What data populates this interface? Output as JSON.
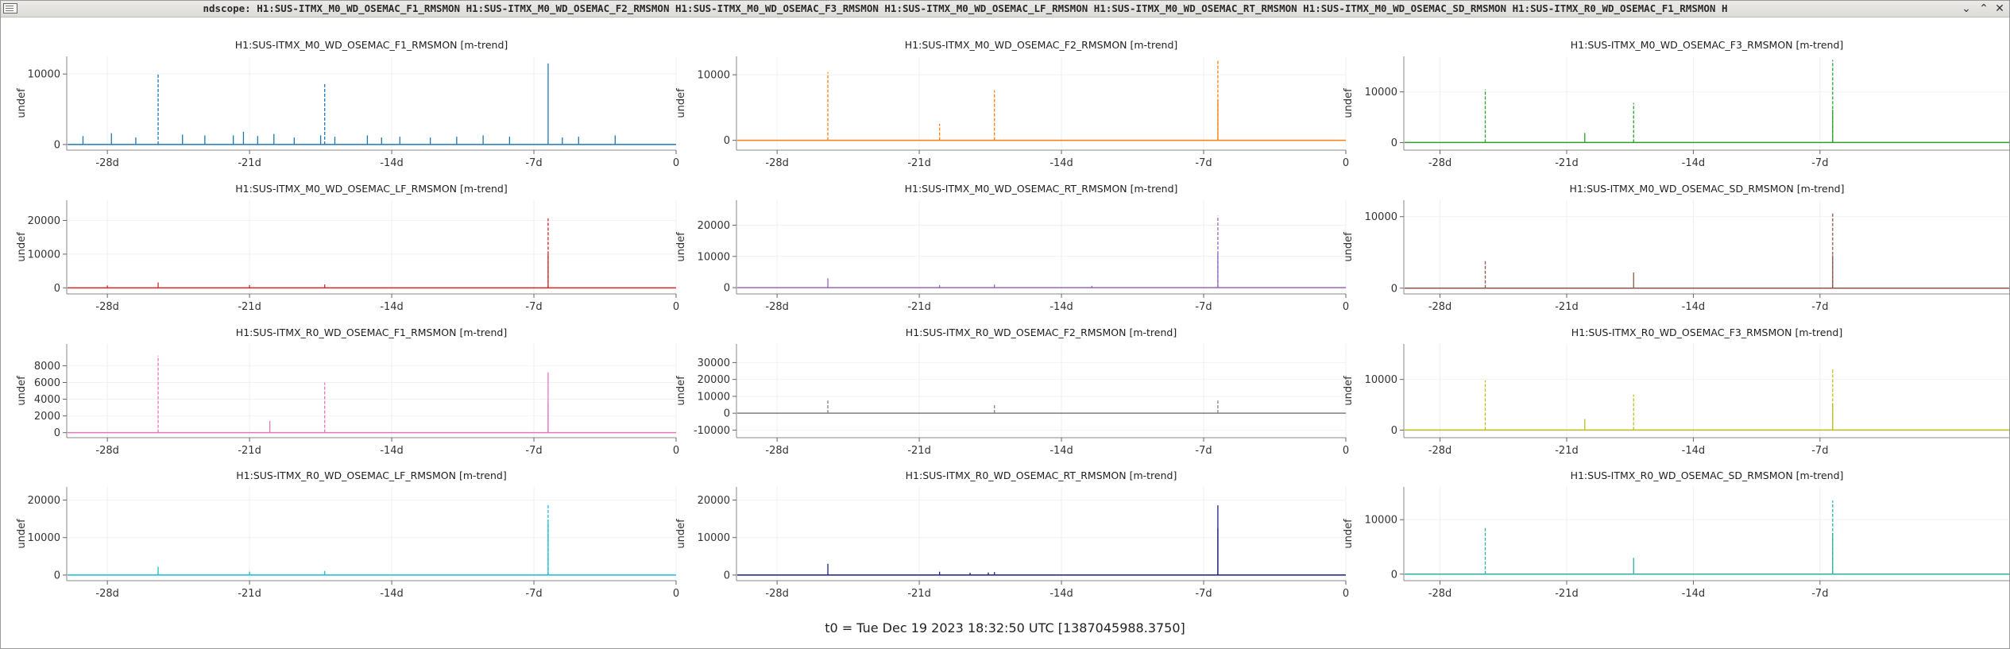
{
  "window": {
    "title": "ndscope: H1:SUS-ITMX_M0_WD_OSEMAC_F1_RMSMON H1:SUS-ITMX_M0_WD_OSEMAC_F2_RMSMON H1:SUS-ITMX_M0_WD_OSEMAC_F3_RMSMON H1:SUS-ITMX_M0_WD_OSEMAC_LF_RMSMON H1:SUS-ITMX_M0_WD_OSEMAC_RT_RMSMON H1:SUS-ITMX_M0_WD_OSEMAC_SD_RMSMON H1:SUS-ITMX_R0_WD_OSEMAC_F1_RMSMON H",
    "minimize_icon": "chevron-down-icon",
    "maximize_icon": "chevron-up-icon",
    "close_icon": "close-icon",
    "min_glyph": "⌄",
    "max_glyph": "⌃",
    "close_glyph": "✕"
  },
  "t0_label": "t0 = Tue Dec 19 2023 18:32:50 UTC [1387045988.3750]",
  "chart_data": [
    {
      "type": "line",
      "title": "H1:SUS-ITMX_M0_WD_OSEMAC_F1_RMSMON [m-trend]",
      "ylabel": "undef",
      "color": "#1f77b4",
      "xlim": [
        -30,
        0
      ],
      "ylim": [
        -800,
        12500
      ],
      "xticks": [
        {
          "v": -28,
          "label": "-28d"
        },
        {
          "v": -21,
          "label": "-21d"
        },
        {
          "v": -14,
          "label": "-14d"
        },
        {
          "v": -7,
          "label": "-7d"
        },
        {
          "v": 0,
          "label": "0"
        }
      ],
      "yticks": [
        {
          "v": 0,
          "label": "0"
        },
        {
          "v": 10000,
          "label": "10000"
        }
      ],
      "spikes": [
        {
          "x": -29.2,
          "y": 1200
        },
        {
          "x": -27.8,
          "y": 1600
        },
        {
          "x": -26.6,
          "y": 1000
        },
        {
          "x": -25.5,
          "y": 10000,
          "dashed": true
        },
        {
          "x": -24.3,
          "y": 1400
        },
        {
          "x": -23.2,
          "y": 1300
        },
        {
          "x": -21.8,
          "y": 1300
        },
        {
          "x": -21.3,
          "y": 1800
        },
        {
          "x": -20.6,
          "y": 1200
        },
        {
          "x": -19.8,
          "y": 1500
        },
        {
          "x": -18.8,
          "y": 1000
        },
        {
          "x": -17.5,
          "y": 1300
        },
        {
          "x": -17.3,
          "y": 8800,
          "dashed": true
        },
        {
          "x": -16.8,
          "y": 1100
        },
        {
          "x": -15.2,
          "y": 1300
        },
        {
          "x": -14.5,
          "y": 1000
        },
        {
          "x": -13.6,
          "y": 1100
        },
        {
          "x": -12.1,
          "y": 1000
        },
        {
          "x": -10.8,
          "y": 1100
        },
        {
          "x": -9.5,
          "y": 1300
        },
        {
          "x": -8.2,
          "y": 1100
        },
        {
          "x": -6.3,
          "y": 11500
        },
        {
          "x": -5.6,
          "y": 1000
        },
        {
          "x": -4.8,
          "y": 1100
        },
        {
          "x": -3.0,
          "y": 1300
        }
      ]
    },
    {
      "type": "line",
      "title": "H1:SUS-ITMX_M0_WD_OSEMAC_F2_RMSMON [m-trend]",
      "ylabel": "undef",
      "color": "#ff7f0e",
      "xlim": [
        -30,
        0
      ],
      "ylim": [
        -1500,
        12800
      ],
      "xticks": [
        {
          "v": -28,
          "label": "-28d"
        },
        {
          "v": -21,
          "label": "-21d"
        },
        {
          "v": -14,
          "label": "-14d"
        },
        {
          "v": -7,
          "label": "-7d"
        },
        {
          "v": 0,
          "label": "0"
        }
      ],
      "yticks": [
        {
          "v": 0,
          "label": "0"
        },
        {
          "v": 10000,
          "label": "10000"
        }
      ],
      "spikes": [
        {
          "x": -25.5,
          "y": 10400,
          "dashed": true
        },
        {
          "x": -20.0,
          "y": 2500,
          "dashed": true
        },
        {
          "x": -17.3,
          "y": 7600,
          "dashed": true
        },
        {
          "x": -6.3,
          "y": 12200,
          "dashed": true
        },
        {
          "x": -6.3,
          "y": 6200
        }
      ]
    },
    {
      "type": "line",
      "title": "H1:SUS-ITMX_M0_WD_OSEMAC_F3_RMSMON [m-trend]",
      "ylabel": "undef",
      "color": "#2ca02c",
      "xlim": [
        -30,
        3.5
      ],
      "ylim": [
        -1500,
        17000
      ],
      "xticks": [
        {
          "v": -28,
          "label": "-28d"
        },
        {
          "v": -21,
          "label": "-21d"
        },
        {
          "v": -14,
          "label": "-14d"
        },
        {
          "v": -7,
          "label": "-7d"
        }
      ],
      "yticks": [
        {
          "v": 0,
          "label": "0"
        },
        {
          "v": 10000,
          "label": "10000"
        }
      ],
      "spikes": [
        {
          "x": -25.5,
          "y": 10500,
          "dashed": true
        },
        {
          "x": -20.0,
          "y": 1900
        },
        {
          "x": -17.3,
          "y": 7800,
          "dashed": true
        },
        {
          "x": -6.3,
          "y": 16300,
          "dashed": true
        },
        {
          "x": -6.3,
          "y": 6500
        }
      ]
    },
    {
      "type": "line",
      "title": "H1:SUS-ITMX_M0_WD_OSEMAC_LF_RMSMON [m-trend]",
      "ylabel": "undef",
      "color": "#d62728",
      "xlim": [
        -30,
        0
      ],
      "ylim": [
        -1800,
        26000
      ],
      "xticks": [
        {
          "v": -28,
          "label": "-28d"
        },
        {
          "v": -21,
          "label": "-21d"
        },
        {
          "v": -14,
          "label": "-14d"
        },
        {
          "v": -7,
          "label": "-7d"
        },
        {
          "v": 0,
          "label": "0"
        }
      ],
      "yticks": [
        {
          "v": 0,
          "label": "0"
        },
        {
          "v": 10000,
          "label": "10000"
        },
        {
          "v": 20000,
          "label": "20000"
        }
      ],
      "spikes": [
        {
          "x": -28.0,
          "y": 700
        },
        {
          "x": -25.5,
          "y": 1600
        },
        {
          "x": -21.0,
          "y": 800
        },
        {
          "x": -17.3,
          "y": 1000
        },
        {
          "x": -6.3,
          "y": 20600,
          "dashed": true
        },
        {
          "x": -6.3,
          "y": 10000
        }
      ]
    },
    {
      "type": "line",
      "title": "H1:SUS-ITMX_M0_WD_OSEMAC_RT_RMSMON [m-trend]",
      "ylabel": "undef",
      "color": "#9467bd",
      "xlim": [
        -30,
        0
      ],
      "ylim": [
        -2000,
        28000
      ],
      "xticks": [
        {
          "v": -28,
          "label": "-28d"
        },
        {
          "v": -21,
          "label": "-21d"
        },
        {
          "v": -14,
          "label": "-14d"
        },
        {
          "v": -7,
          "label": "-7d"
        },
        {
          "v": 0,
          "label": "0"
        }
      ],
      "yticks": [
        {
          "v": 0,
          "label": "0"
        },
        {
          "v": 10000,
          "label": "10000"
        },
        {
          "v": 20000,
          "label": "20000"
        }
      ],
      "spikes": [
        {
          "x": -25.5,
          "y": 3000
        },
        {
          "x": -20.0,
          "y": 800
        },
        {
          "x": -17.3,
          "y": 1000
        },
        {
          "x": -12.5,
          "y": 600
        },
        {
          "x": -6.3,
          "y": 23000,
          "dashed": true
        },
        {
          "x": -6.3,
          "y": 11000
        }
      ]
    },
    {
      "type": "line",
      "title": "H1:SUS-ITMX_M0_WD_OSEMAC_SD_RMSMON [m-trend]",
      "ylabel": "undef",
      "color": "#8c564b",
      "xlim": [
        -30,
        3.5
      ],
      "ylim": [
        -800,
        12300
      ],
      "xticks": [
        {
          "v": -28,
          "label": "-28d"
        },
        {
          "v": -21,
          "label": "-21d"
        },
        {
          "v": -14,
          "label": "-14d"
        },
        {
          "v": -7,
          "label": "-7d"
        }
      ],
      "yticks": [
        {
          "v": 0,
          "label": "0"
        },
        {
          "v": 10000,
          "label": "10000"
        }
      ],
      "spikes": [
        {
          "x": -25.5,
          "y": 3800,
          "dashed": true
        },
        {
          "x": -17.3,
          "y": 2200
        },
        {
          "x": -6.3,
          "y": 10500,
          "dashed": true
        },
        {
          "x": -6.3,
          "y": 4600
        }
      ]
    },
    {
      "type": "line",
      "title": "H1:SUS-ITMX_R0_WD_OSEMAC_F1_RMSMON [m-trend]",
      "ylabel": "undef",
      "color": "#e377c2",
      "xlim": [
        -30,
        0
      ],
      "ylim": [
        -600,
        10600
      ],
      "xticks": [
        {
          "v": -28,
          "label": "-28d"
        },
        {
          "v": -21,
          "label": "-21d"
        },
        {
          "v": -14,
          "label": "-14d"
        },
        {
          "v": -7,
          "label": "-7d"
        },
        {
          "v": 0,
          "label": "0"
        }
      ],
      "yticks": [
        {
          "v": 0,
          "label": "0"
        },
        {
          "v": 2000,
          "label": "2000"
        },
        {
          "v": 4000,
          "label": "4000"
        },
        {
          "v": 6000,
          "label": "6000"
        },
        {
          "v": 8000,
          "label": "8000"
        }
      ],
      "spikes": [
        {
          "x": -25.5,
          "y": 9200,
          "dashed": true
        },
        {
          "x": -20.0,
          "y": 1400
        },
        {
          "x": -17.3,
          "y": 6000,
          "dashed": true
        },
        {
          "x": -6.3,
          "y": 7200
        },
        {
          "x": -6.3,
          "y": 3400
        }
      ]
    },
    {
      "type": "line",
      "title": "H1:SUS-ITMX_R0_WD_OSEMAC_F2_RMSMON [m-trend]",
      "ylabel": "undef",
      "color": "#7f7f7f",
      "xlim": [
        -30,
        0
      ],
      "ylim": [
        -14500,
        41000
      ],
      "xticks": [
        {
          "v": -28,
          "label": "-28d"
        },
        {
          "v": -21,
          "label": "-21d"
        },
        {
          "v": -14,
          "label": "-14d"
        },
        {
          "v": -7,
          "label": "-7d"
        },
        {
          "v": 0,
          "label": "0"
        }
      ],
      "yticks": [
        {
          "v": -10000,
          "label": "-10000"
        },
        {
          "v": 0,
          "label": "0"
        },
        {
          "v": 10000,
          "label": "10000"
        },
        {
          "v": 20000,
          "label": "20000"
        },
        {
          "v": 30000,
          "label": "30000"
        }
      ],
      "spikes": [
        {
          "x": -25.5,
          "y": 7500,
          "dashed": true
        },
        {
          "x": -17.3,
          "y": 5500,
          "dashed": true
        },
        {
          "x": -6.3,
          "y": 7500,
          "dashed": true
        }
      ]
    },
    {
      "type": "line",
      "title": "H1:SUS-ITMX_R0_WD_OSEMAC_F3_RMSMON [m-trend]",
      "ylabel": "undef",
      "color": "#bcbd22",
      "xlim": [
        -30,
        3.5
      ],
      "ylim": [
        -1500,
        17000
      ],
      "xticks": [
        {
          "v": -28,
          "label": "-28d"
        },
        {
          "v": -21,
          "label": "-21d"
        },
        {
          "v": -14,
          "label": "-14d"
        },
        {
          "v": -7,
          "label": "-7d"
        }
      ],
      "yticks": [
        {
          "v": 0,
          "label": "0"
        },
        {
          "v": 10000,
          "label": "10000"
        }
      ],
      "spikes": [
        {
          "x": -25.5,
          "y": 9800,
          "dashed": true
        },
        {
          "x": -20.0,
          "y": 2200
        },
        {
          "x": -17.3,
          "y": 7000,
          "dashed": true
        },
        {
          "x": -6.3,
          "y": 12000,
          "dashed": true
        },
        {
          "x": -6.3,
          "y": 5200
        }
      ]
    },
    {
      "type": "line",
      "title": "H1:SUS-ITMX_R0_WD_OSEMAC_LF_RMSMON [m-trend]",
      "ylabel": "undef",
      "color": "#17becf",
      "xlim": [
        -30,
        0
      ],
      "ylim": [
        -1500,
        23500
      ],
      "xticks": [
        {
          "v": -28,
          "label": "-28d"
        },
        {
          "v": -21,
          "label": "-21d"
        },
        {
          "v": -14,
          "label": "-14d"
        },
        {
          "v": -7,
          "label": "-7d"
        },
        {
          "v": 0,
          "label": "0"
        }
      ],
      "yticks": [
        {
          "v": 0,
          "label": "0"
        },
        {
          "v": 10000,
          "label": "10000"
        },
        {
          "v": 20000,
          "label": "20000"
        }
      ],
      "spikes": [
        {
          "x": -25.5,
          "y": 2200
        },
        {
          "x": -21.0,
          "y": 900
        },
        {
          "x": -17.3,
          "y": 1100
        },
        {
          "x": -6.3,
          "y": 19000,
          "dashed": true
        },
        {
          "x": -6.3,
          "y": 14000
        }
      ]
    },
    {
      "type": "line",
      "title": "H1:SUS-ITMX_R0_WD_OSEMAC_RT_RMSMON [m-trend]",
      "ylabel": "undef",
      "color": "#1a1f7a",
      "xlim": [
        -30,
        0
      ],
      "ylim": [
        -1500,
        23500
      ],
      "xticks": [
        {
          "v": -28,
          "label": "-28d"
        },
        {
          "v": -21,
          "label": "-21d"
        },
        {
          "v": -14,
          "label": "-14d"
        },
        {
          "v": -7,
          "label": "-7d"
        },
        {
          "v": 0,
          "label": "0"
        }
      ],
      "yticks": [
        {
          "v": 0,
          "label": "0"
        },
        {
          "v": 10000,
          "label": "10000"
        },
        {
          "v": 20000,
          "label": "20000"
        }
      ],
      "spikes": [
        {
          "x": -25.5,
          "y": 3000
        },
        {
          "x": -20.0,
          "y": 900
        },
        {
          "x": -18.5,
          "y": 600
        },
        {
          "x": -17.6,
          "y": 700
        },
        {
          "x": -17.3,
          "y": 800
        },
        {
          "x": -6.3,
          "y": 18600
        },
        {
          "x": -6.3,
          "y": 12500
        }
      ]
    },
    {
      "type": "line",
      "title": "H1:SUS-ITMX_R0_WD_OSEMAC_SD_RMSMON [m-trend]",
      "ylabel": "undef",
      "color": "#2ab0a5",
      "xlim": [
        -30,
        3.5
      ],
      "ylim": [
        -1200,
        16000
      ],
      "xticks": [
        {
          "v": -28,
          "label": "-28d"
        },
        {
          "v": -21,
          "label": "-21d"
        },
        {
          "v": -14,
          "label": "-14d"
        },
        {
          "v": -7,
          "label": "-7d"
        }
      ],
      "yticks": [
        {
          "v": 0,
          "label": "0"
        },
        {
          "v": 10000,
          "label": "10000"
        }
      ],
      "spikes": [
        {
          "x": -25.5,
          "y": 8500,
          "dashed": true
        },
        {
          "x": -17.3,
          "y": 3000
        },
        {
          "x": -6.3,
          "y": 13500,
          "dashed": true
        },
        {
          "x": -6.3,
          "y": 7500
        }
      ]
    }
  ]
}
